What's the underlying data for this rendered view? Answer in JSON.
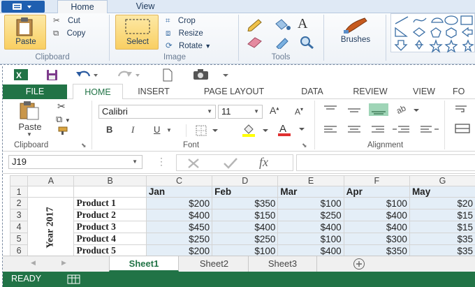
{
  "paint": {
    "tabs": [
      "Home",
      "View"
    ],
    "clipboard": {
      "paste": "Paste",
      "cut": "Cut",
      "copy": "Copy",
      "group": "Clipboard"
    },
    "image": {
      "select": "Select",
      "crop": "Crop",
      "resize": "Resize",
      "rotate": "Rotate",
      "group": "Image"
    },
    "tools": {
      "group": "Tools"
    },
    "brushes": {
      "label": "Brushes"
    }
  },
  "excel": {
    "tabs": [
      "FILE",
      "HOME",
      "INSERT",
      "PAGE LAYOUT",
      "DATA",
      "REVIEW",
      "VIEW",
      "FO"
    ],
    "ribbon": {
      "paste": "Paste",
      "clipboard_group": "Clipboard",
      "font_name": "Calibri",
      "font_size": "11",
      "font_group": "Font",
      "alignment_group": "Alignment",
      "bold": "B",
      "italic": "I",
      "underline": "U"
    },
    "name_box": "J19",
    "fx": "fx",
    "columns": [
      "A",
      "B",
      "C",
      "D",
      "E",
      "F",
      "G"
    ],
    "header_row": [
      "",
      "",
      "Jan",
      "Feb",
      "Mar",
      "Apr",
      "May"
    ],
    "year_label": "Year 2017",
    "rows": [
      {
        "num": "2",
        "product": "Product 1",
        "values": [
          "$200",
          "$350",
          "$100",
          "$100",
          "$20"
        ]
      },
      {
        "num": "3",
        "product": "Product 2",
        "values": [
          "$400",
          "$150",
          "$250",
          "$400",
          "$15"
        ]
      },
      {
        "num": "4",
        "product": "Product 3",
        "values": [
          "$450",
          "$400",
          "$400",
          "$400",
          "$15"
        ]
      },
      {
        "num": "5",
        "product": "Product 4",
        "values": [
          "$250",
          "$250",
          "$100",
          "$300",
          "$35"
        ]
      },
      {
        "num": "6",
        "product": "Product 5",
        "values": [
          "$200",
          "$100",
          "$400",
          "$350",
          "$35"
        ]
      }
    ],
    "sheet_tabs": [
      "Sheet1",
      "Sheet2",
      "Sheet3"
    ],
    "status": "READY",
    "colors": {
      "excel_green": "#217346",
      "paint_blue": "#1f5fb0",
      "cell_fill": "#e4eef7"
    }
  }
}
